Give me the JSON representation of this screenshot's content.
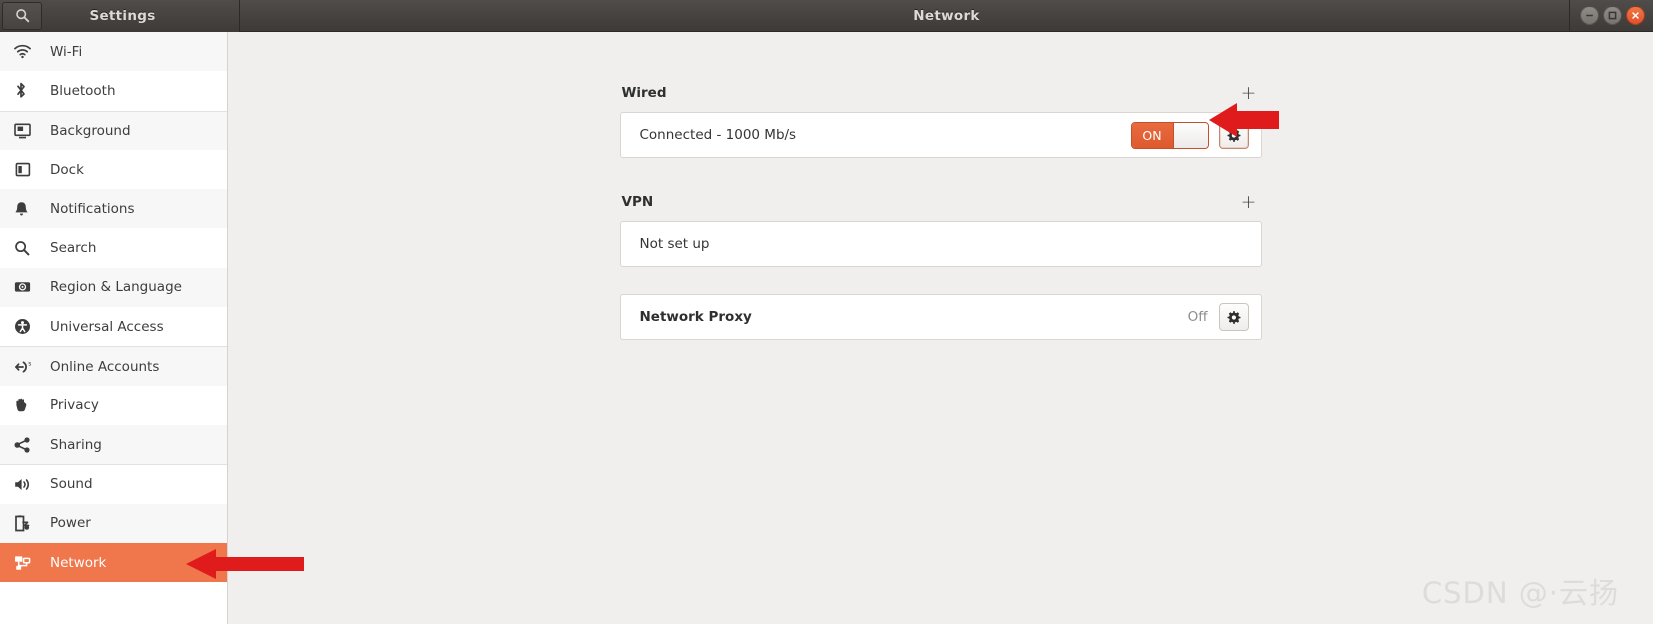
{
  "titlebar": {
    "search_icon": "search-icon",
    "settings_title": "Settings",
    "window_title": "Network",
    "minimize_label": "−",
    "maximize_label": "□",
    "close_label": "✕"
  },
  "sidebar": {
    "items": [
      {
        "label": "Wi-Fi",
        "icon": "wifi-icon",
        "key": "wifi"
      },
      {
        "label": "Bluetooth",
        "icon": "bluetooth-icon",
        "key": "bluetooth"
      },
      {
        "label": "Background",
        "icon": "background-icon",
        "key": "background"
      },
      {
        "label": "Dock",
        "icon": "dock-icon",
        "key": "dock"
      },
      {
        "label": "Notifications",
        "icon": "bell-icon",
        "key": "notifications"
      },
      {
        "label": "Search",
        "icon": "search-icon",
        "key": "search"
      },
      {
        "label": "Region & Language",
        "icon": "region-language-icon",
        "key": "region-language"
      },
      {
        "label": "Universal Access",
        "icon": "accessibility-icon",
        "key": "universal-access"
      },
      {
        "label": "Online Accounts",
        "icon": "online-accounts-icon",
        "key": "online-accounts"
      },
      {
        "label": "Privacy",
        "icon": "hand-icon",
        "key": "privacy"
      },
      {
        "label": "Sharing",
        "icon": "share-icon",
        "key": "sharing"
      },
      {
        "label": "Sound",
        "icon": "speaker-icon",
        "key": "sound"
      },
      {
        "label": "Power",
        "icon": "battery-icon",
        "key": "power"
      },
      {
        "label": "Network",
        "icon": "network-icon",
        "key": "network"
      }
    ],
    "active_key": "network"
  },
  "main": {
    "wired": {
      "title": "Wired",
      "add_label": "+",
      "status": "Connected - 1000 Mb/s",
      "toggle_state": "ON",
      "settings_icon": "gear-icon"
    },
    "vpn": {
      "title": "VPN",
      "add_label": "+",
      "status": "Not set up"
    },
    "proxy": {
      "title": "Network Proxy",
      "status": "Off",
      "settings_icon": "gear-icon"
    }
  },
  "annotations": {
    "arrow_gear": "red-arrow-icon",
    "arrow_network": "red-arrow-icon"
  },
  "watermark": {
    "text": "CSDN @·云扬"
  },
  "colors": {
    "accent": "#e8784a",
    "active_bg": "#f0764b",
    "annotation": "#e01b1b",
    "titlebar": "#453f3c"
  }
}
